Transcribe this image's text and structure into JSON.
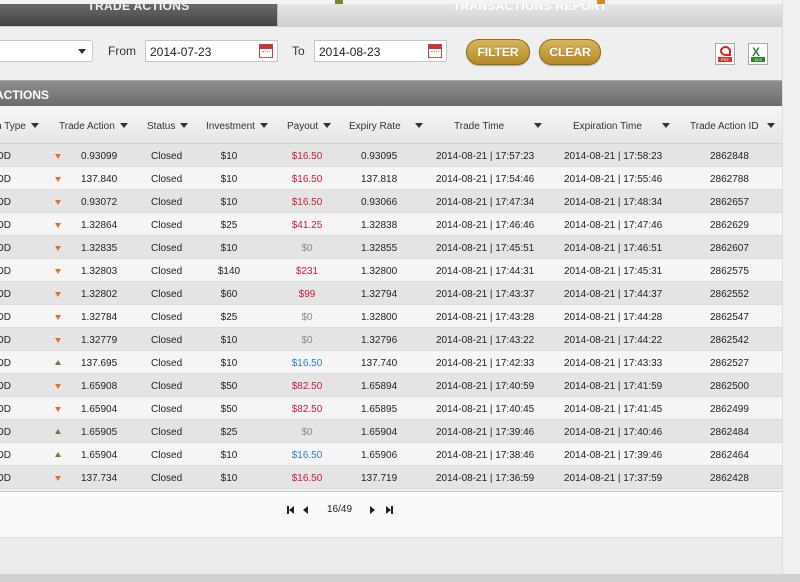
{
  "tabs": [
    {
      "label": "TRADE ACTIONS",
      "active": true
    },
    {
      "label": "TRANSACTIONS REPORT",
      "active": false
    }
  ],
  "filter": {
    "select_value": "",
    "from_label": "From",
    "from_value": "2014-07-23",
    "to_label": "To",
    "to_value": "2014-08-23",
    "filter_button": "FILTER",
    "clear_button": "CLEAR",
    "pdf_icon": "pdf-icon",
    "excel_icon": "excel-icon",
    "pdf_band": "PDF",
    "excel_band": "XLS",
    "excel_glyph": "X"
  },
  "section_title": "ACTIONS",
  "columns": [
    "n Type",
    "Trade Action",
    "Status",
    "Investment",
    "Payout",
    "Expiry Rate",
    "Trade Time",
    "Expiration Time",
    "Trade Action ID"
  ],
  "rows": [
    {
      "type": "OD",
      "dir": "down",
      "action": "0.93099",
      "status": "Closed",
      "investment": "$10",
      "payout": "$16.50",
      "payout_style": "red",
      "expiry": "0.93095",
      "trade_time": "2014-08-21 | 17:57:23",
      "exp_time": "2014-08-21 | 17:58:23",
      "id": "2862848"
    },
    {
      "type": "OD",
      "dir": "down",
      "action": "137.840",
      "status": "Closed",
      "investment": "$10",
      "payout": "$16.50",
      "payout_style": "red",
      "expiry": "137.818",
      "trade_time": "2014-08-21 | 17:54:46",
      "exp_time": "2014-08-21 | 17:55:46",
      "id": "2862788"
    },
    {
      "type": "OD",
      "dir": "down",
      "action": "0.93072",
      "status": "Closed",
      "investment": "$10",
      "payout": "$16.50",
      "payout_style": "red",
      "expiry": "0.93066",
      "trade_time": "2014-08-21 | 17:47:34",
      "exp_time": "2014-08-21 | 17:48:34",
      "id": "2862657"
    },
    {
      "type": "OD",
      "dir": "down",
      "action": "1.32864",
      "status": "Closed",
      "investment": "$25",
      "payout": "$41.25",
      "payout_style": "red",
      "expiry": "1.32838",
      "trade_time": "2014-08-21 | 17:46:46",
      "exp_time": "2014-08-21 | 17:47:46",
      "id": "2862629"
    },
    {
      "type": "OD",
      "dir": "down",
      "action": "1.32835",
      "status": "Closed",
      "investment": "$10",
      "payout": "$0",
      "payout_style": "zero",
      "expiry": "1.32855",
      "trade_time": "2014-08-21 | 17:45:51",
      "exp_time": "2014-08-21 | 17:46:51",
      "id": "2862607"
    },
    {
      "type": "OD",
      "dir": "down",
      "action": "1.32803",
      "status": "Closed",
      "investment": "$140",
      "payout": "$231",
      "payout_style": "red",
      "expiry": "1.32800",
      "trade_time": "2014-08-21 | 17:44:31",
      "exp_time": "2014-08-21 | 17:45:31",
      "id": "2862575"
    },
    {
      "type": "OD",
      "dir": "down",
      "action": "1.32802",
      "status": "Closed",
      "investment": "$60",
      "payout": "$99",
      "payout_style": "red",
      "expiry": "1.32794",
      "trade_time": "2014-08-21 | 17:43:37",
      "exp_time": "2014-08-21 | 17:44:37",
      "id": "2862552"
    },
    {
      "type": "OD",
      "dir": "down",
      "action": "1.32784",
      "status": "Closed",
      "investment": "$25",
      "payout": "$0",
      "payout_style": "zero",
      "expiry": "1.32800",
      "trade_time": "2014-08-21 | 17:43:28",
      "exp_time": "2014-08-21 | 17:44:28",
      "id": "2862547"
    },
    {
      "type": "OD",
      "dir": "down",
      "action": "1.32779",
      "status": "Closed",
      "investment": "$10",
      "payout": "$0",
      "payout_style": "zero",
      "expiry": "1.32796",
      "trade_time": "2014-08-21 | 17:43:22",
      "exp_time": "2014-08-21 | 17:44:22",
      "id": "2862542"
    },
    {
      "type": "OD",
      "dir": "up",
      "action": "137.695",
      "status": "Closed",
      "investment": "$10",
      "payout": "$16.50",
      "payout_style": "blue",
      "expiry": "137.740",
      "trade_time": "2014-08-21 | 17:42:33",
      "exp_time": "2014-08-21 | 17:43:33",
      "id": "2862527"
    },
    {
      "type": "OD",
      "dir": "down",
      "action": "1.65908",
      "status": "Closed",
      "investment": "$50",
      "payout": "$82.50",
      "payout_style": "red",
      "expiry": "1.65894",
      "trade_time": "2014-08-21 | 17:40:59",
      "exp_time": "2014-08-21 | 17:41:59",
      "id": "2862500"
    },
    {
      "type": "OD",
      "dir": "down",
      "action": "1.65904",
      "status": "Closed",
      "investment": "$50",
      "payout": "$82.50",
      "payout_style": "red",
      "expiry": "1.65895",
      "trade_time": "2014-08-21 | 17:40:45",
      "exp_time": "2014-08-21 | 17:41:45",
      "id": "2862499"
    },
    {
      "type": "OD",
      "dir": "up",
      "action": "1.65905",
      "status": "Closed",
      "investment": "$25",
      "payout": "$0",
      "payout_style": "zero",
      "expiry": "1.65904",
      "trade_time": "2014-08-21 | 17:39:46",
      "exp_time": "2014-08-21 | 17:40:46",
      "id": "2862484"
    },
    {
      "type": "OD",
      "dir": "up",
      "action": "1.65904",
      "status": "Closed",
      "investment": "$10",
      "payout": "$16.50",
      "payout_style": "blue",
      "expiry": "1.65906",
      "trade_time": "2014-08-21 | 17:38:46",
      "exp_time": "2014-08-21 | 17:39:46",
      "id": "2862464"
    },
    {
      "type": "OD",
      "dir": "down",
      "action": "137.734",
      "status": "Closed",
      "investment": "$10",
      "payout": "$16.50",
      "payout_style": "red",
      "expiry": "137.719",
      "trade_time": "2014-08-21 | 17:36:59",
      "exp_time": "2014-08-21 | 17:37:59",
      "id": "2862428"
    }
  ],
  "pagination": {
    "page_text": "16/49"
  },
  "colors": {
    "accent_gold": "#c9a23d",
    "payout_red": "#cc1b3a",
    "payout_blue": "#2a7fc4",
    "arrow_down": "#e0702a",
    "arrow_up": "#5a8a2a"
  }
}
